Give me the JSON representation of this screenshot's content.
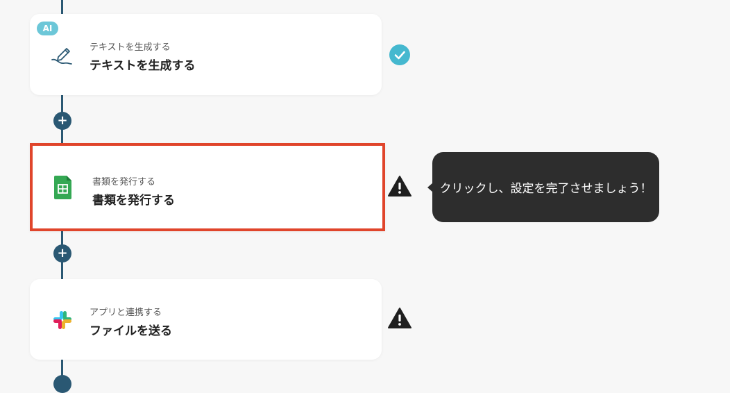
{
  "steps": [
    {
      "badge": "AI",
      "subtitle": "テキストを生成する",
      "title": "テキストを生成する",
      "icon": "pen-icon",
      "status": "completed",
      "status_icon": "check-circle-icon"
    },
    {
      "subtitle": "書類を発行する",
      "title": "書類を発行する",
      "icon": "google-sheets-icon",
      "status": "warning",
      "status_icon": "warning-icon",
      "selected": true
    },
    {
      "subtitle": "アプリと連携する",
      "title": "ファイルを送る",
      "icon": "slack-icon",
      "status": "warning",
      "status_icon": "warning-icon"
    }
  ],
  "add_button_label": "+",
  "tooltip": {
    "text": "クリックし、設定を完了させましょう！"
  },
  "colors": {
    "background": "#f7f7f7",
    "flow_line": "#2a5873",
    "selected_border": "#e0452b",
    "ai_badge": "#6cc7d8",
    "check": "#45b8cf",
    "sheets_green": "#34a853",
    "tooltip_bg": "#2d2d2d"
  }
}
